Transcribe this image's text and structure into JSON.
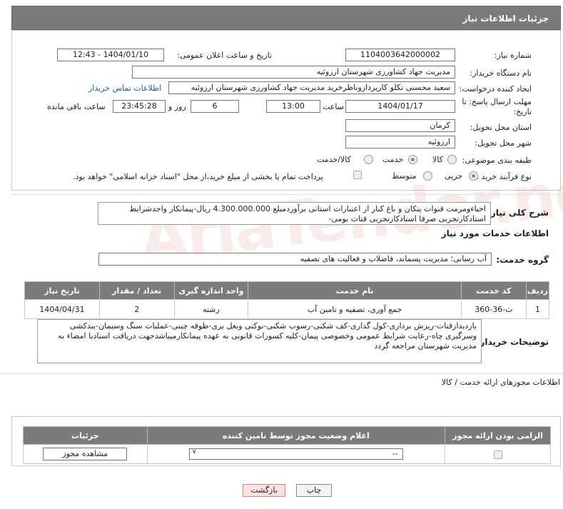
{
  "header": {
    "title": "جزئیات اطلاعات نیاز"
  },
  "form": {
    "need_number_label": "شماره نیاز:",
    "need_number": "1104003642000002",
    "announce_label": "تاریخ و ساعت اعلان عمومی:",
    "announce_value": "1404/01/10 - 12:43",
    "buyer_org_label": "نام دستگاه خریدار:",
    "buyer_org": "مدیریت جهاد کشاورزی شهرستان ارزوئیه",
    "creator_label": "ایجاد کننده درخواست:",
    "creator": "سعید محسنی تکلو کارپردازوناظرخرید مدیریت جهاد کشاورزی شهرستان ارزوئیه",
    "contact_link": "اطلاعات تماس خریدار",
    "deadline_label_1": "مهلت ارسال پاسخ: تا",
    "deadline_label_2": "تاریخ:",
    "deadline_date": "1404/01/17",
    "time_label": "ساعت",
    "deadline_time": "13:00",
    "days_value": "6",
    "days_label": "روز و",
    "remaining_time": "23:45:28",
    "remaining_label": "ساعت باقی مانده",
    "province_label": "استان محل تحویل:",
    "province": "کرمان",
    "city_label": "شهر محل تحویل:",
    "city": "ارزوئیه",
    "category_label": "طبقه بندی موضوعی:",
    "category_options": [
      "کالا",
      "خدمت",
      "کالا/خدمت"
    ],
    "category_selected": "خدمت",
    "process_label": "نوع فرآیند خرید :",
    "process_options": [
      "جزیی",
      "متوسط"
    ],
    "process_selected": "جزیی",
    "payment_note": "پرداخت تمام یا بخشی از مبلغ خرید،از محل \"اسناد خزانه اسلامی\" خواهد بود."
  },
  "description": {
    "label": "شرح کلی نیاز:",
    "text": "احیاءومرمت قنوات پتکان و باغ کنار از اعتبارات استانی برآوردمبلغ 4.300.000.000 ریال-پیمانکار واجدشرایط استادکارتجربی صرفا استادکارتجربی قنات بومی-"
  },
  "services": {
    "section_title": "اطلاعات خدمات مورد نیاز",
    "group_label": "گروه خدمت:",
    "group_value": "آب رسانی؛ مدیریت پسماند، فاضلاب و فعالیت های تصفیه",
    "columns": [
      "ردیف",
      "کد خدمت",
      "نام خدمت",
      "واحد اندازه گیری",
      "تعداد / مقدار",
      "تاریخ نیاز"
    ],
    "rows": [
      {
        "index": "1",
        "code": "ث-36-360",
        "name": "جمع آوری، تصفیه و تامین آب",
        "unit": "رشته",
        "qty": "2",
        "date": "1404/04/31"
      }
    ]
  },
  "buyer_notes": {
    "label": "توضیحات خریدار:",
    "text": "بازدیدازقنات-ریزش برداری-کول گذاری-کف شکنی-رسوب شکنی-نوکنی وبغل بری-طوقه چینی-عملیات سنگ وسیمان-بندکشی وسرگیری چاه-رعایت شرایط عمومی وخصوصی پیمان-کلیه کسورات قانونی به عهده پیمانکارمیباشدجهت دریافت اسنادبا امضاء به مدیریت شهرستان مراجعه گردد"
  },
  "permits": {
    "section_title": "اطلاعات مجوزهای ارائه خدمت / کالا",
    "columns": [
      "الزامی بودن ارائه مجوز",
      "اعلام وضعیت مجوز توسط نامین کننده",
      "جزئیات"
    ],
    "select_value": "--",
    "view_button": "مشاهده مجوز"
  },
  "footer": {
    "print": "چاپ",
    "back": "بازگشت"
  },
  "watermark": "AriaTender.neT"
}
